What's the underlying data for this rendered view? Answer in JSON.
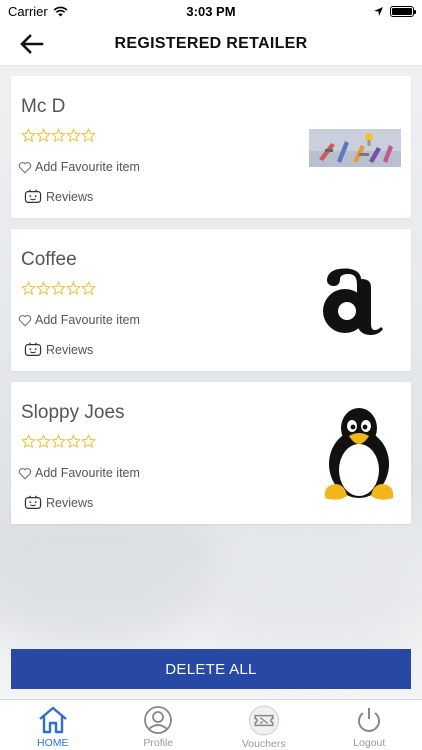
{
  "status_bar": {
    "carrier": "Carrier",
    "time": "3:03 PM"
  },
  "nav": {
    "title": "REGISTERED RETAILER"
  },
  "retailers": [
    {
      "name": "Mc D",
      "rating": 0,
      "fav_label": "Add Favourite item",
      "reviews_label": "Reviews",
      "logo": "tools-banner-image"
    },
    {
      "name": "Coffee",
      "rating": 0,
      "fav_label": "Add Favourite item",
      "reviews_label": "Reviews",
      "logo": "letter-a-logo"
    },
    {
      "name": "Sloppy Joes",
      "rating": 0,
      "fav_label": "Add Favourite item",
      "reviews_label": "Reviews",
      "logo": "penguin-logo"
    }
  ],
  "actions": {
    "delete_all": "DELETE ALL"
  },
  "tabs": [
    {
      "label": "HOME",
      "icon": "home-icon",
      "active": true
    },
    {
      "label": "Profile",
      "icon": "profile-icon",
      "active": false
    },
    {
      "label": "Vouchers",
      "icon": "voucher-icon",
      "active": false
    },
    {
      "label": "Logout",
      "icon": "power-icon",
      "active": false
    }
  ],
  "colors": {
    "accent": "#2748a4",
    "tab_active": "#2f6fcc",
    "star": "#e8c33a"
  }
}
